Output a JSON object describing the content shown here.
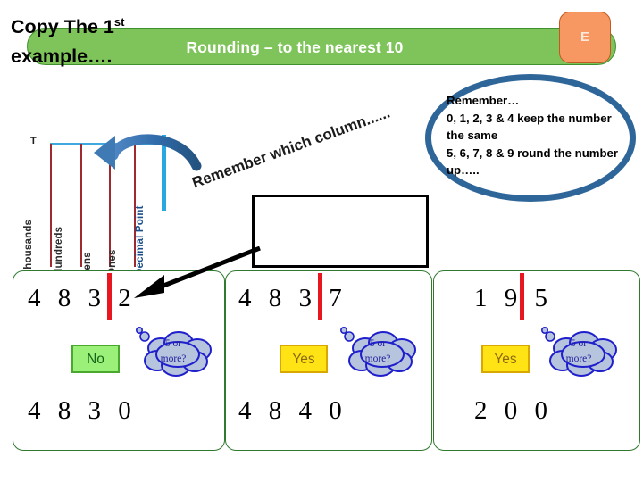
{
  "header": {
    "title": "Rounding – to the nearest 10",
    "badge_letter": "E",
    "bar_color": "#7ec45a",
    "badge_color": "#f79862"
  },
  "remember_oval": {
    "text": "Remember…\n0, 1, 2, 3 & 4 keep the number the same\n5, 6, 7, 8 & 9 round the number up…..",
    "border_color": "#2f6699"
  },
  "place_value_chart": {
    "top_marker": "T",
    "columns": [
      {
        "label": "Thousands",
        "color": "#9e2a2f"
      },
      {
        "label": "Hundreds",
        "color": "#9e2a2f"
      },
      {
        "label": "Tens",
        "color": "#9e2a2f"
      },
      {
        "label": "Ones",
        "color": "#9e2a2f"
      },
      {
        "label": "Decimal Point",
        "color": "#29a7e1"
      }
    ],
    "top_line_color": "#3fa9df",
    "arrow_color": "#2f6aa8"
  },
  "annotations": {
    "remember_column": "Remember which column......",
    "copy_example_line1": "Copy The 1",
    "copy_example_sup": "st",
    "copy_example_line2": "example…."
  },
  "examples": [
    {
      "number_digits": "4 8 3 2",
      "divider_after": 3,
      "decision_label": "No",
      "decision_type": "no",
      "cloud_line1": "5 or",
      "cloud_line2": "more?",
      "answer_digits": "4 8 3 0"
    },
    {
      "number_digits": "4 8 3 7",
      "divider_after": 3,
      "decision_label": "Yes",
      "decision_type": "yes",
      "cloud_line1": "5 or",
      "cloud_line2": "more?",
      "answer_digits": "4 8 4 0"
    },
    {
      "number_digits": "1 9 5",
      "divider_after": 2,
      "decision_label": "Yes",
      "decision_type": "yes",
      "cloud_line1": "5 or",
      "cloud_line2": "more?",
      "answer_digits": "2 0 0"
    }
  ],
  "colors": {
    "divider_red": "#e8171f",
    "panel_border": "#2f7a2f",
    "cloud_fill": "#b7c4dd",
    "cloud_stroke": "#1f1fcc"
  }
}
